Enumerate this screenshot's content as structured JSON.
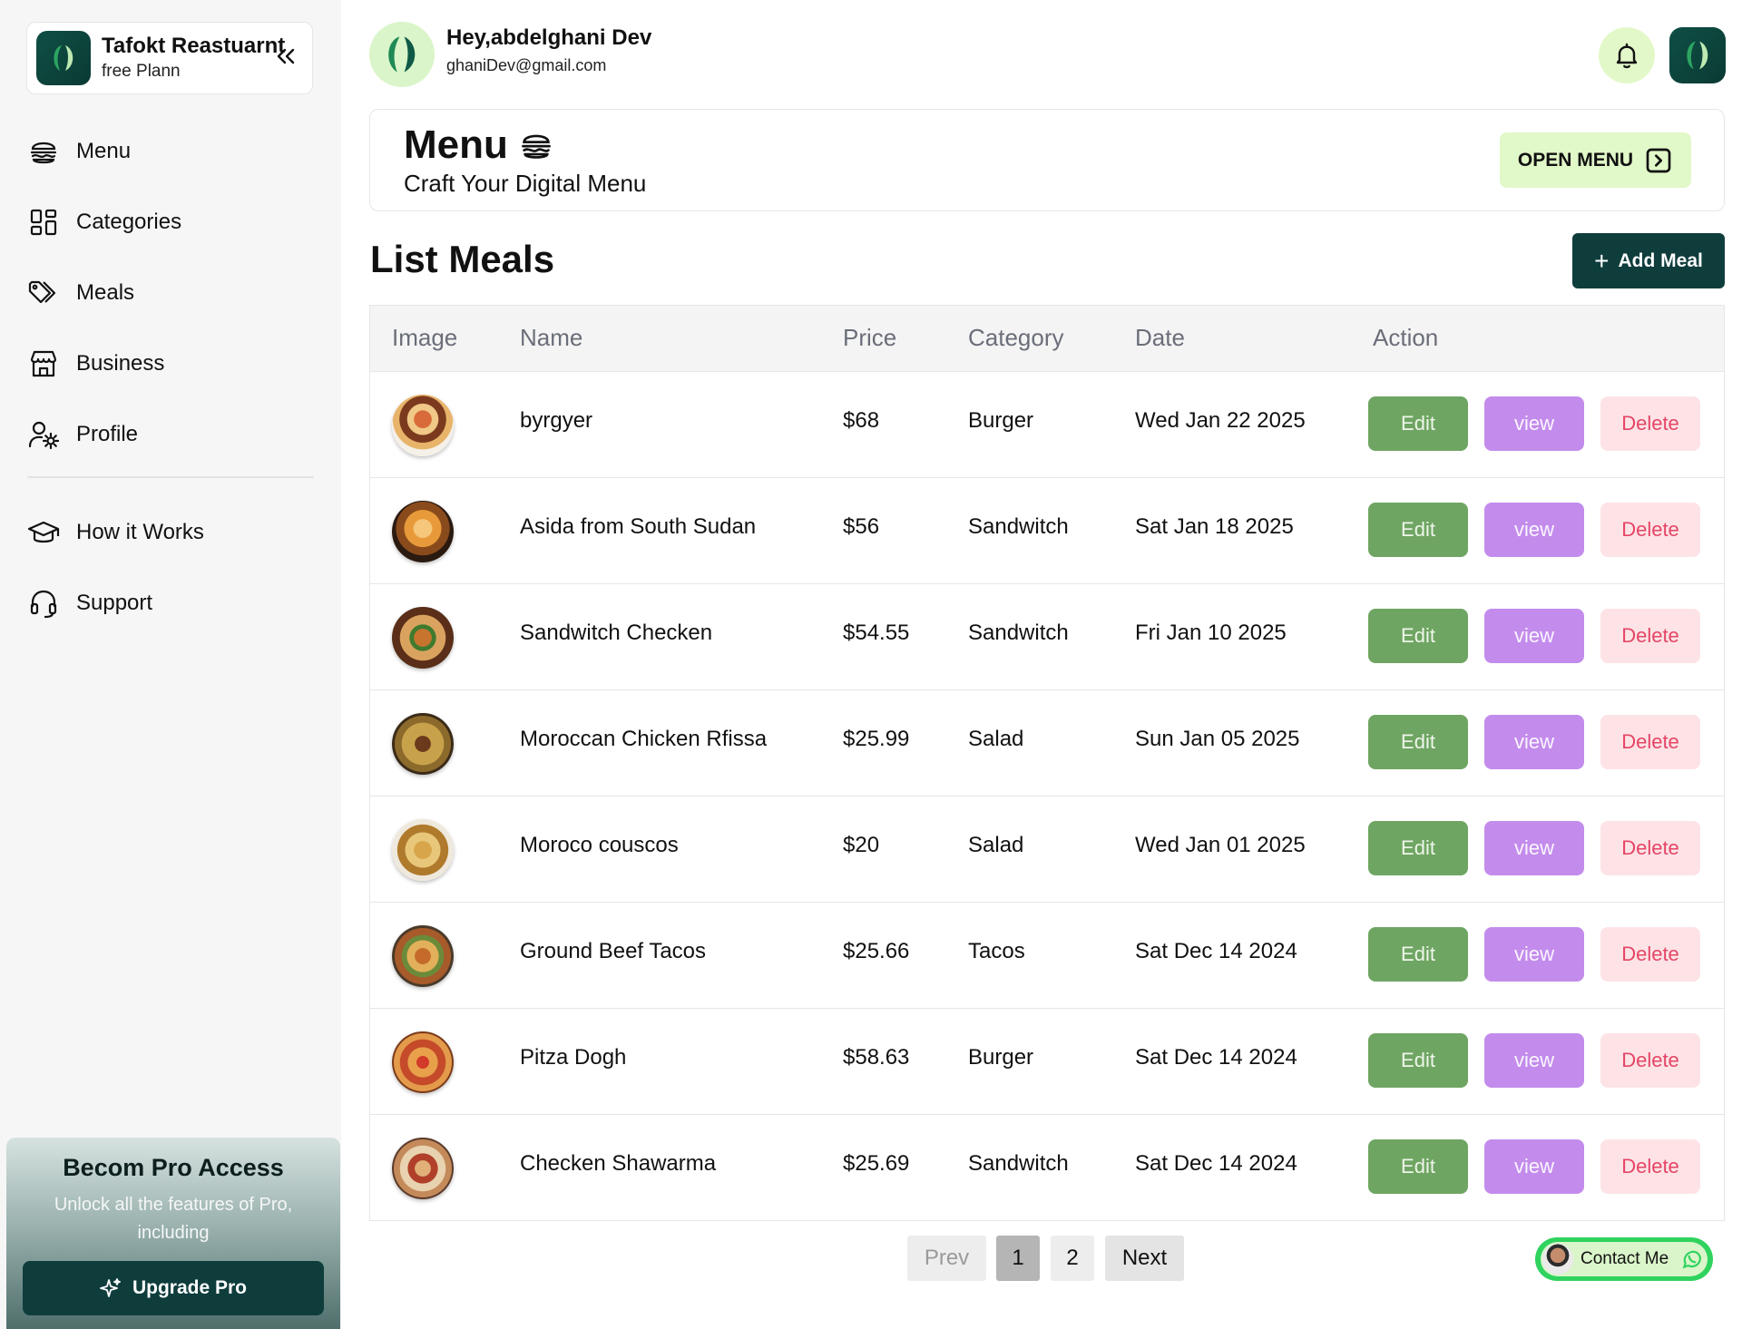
{
  "sidebar": {
    "brand_name": "Tafokt Reastuarnt",
    "brand_plan": "free Plann",
    "items": [
      {
        "label": "Menu",
        "icon": "burger-icon"
      },
      {
        "label": "Categories",
        "icon": "grid-icon"
      },
      {
        "label": "Meals",
        "icon": "tags-icon"
      },
      {
        "label": "Business",
        "icon": "store-icon"
      },
      {
        "label": "Profile",
        "icon": "user-gear-icon"
      }
    ],
    "secondary_items": [
      {
        "label": "How it Works",
        "icon": "graduation-cap-icon"
      },
      {
        "label": "Support",
        "icon": "headset-icon"
      }
    ],
    "pro": {
      "title": "Becom Pro Access",
      "description": "Unlock all the features of Pro, including",
      "button_label": "Upgrade Pro"
    }
  },
  "header": {
    "greeting": "Hey,abdelghani Dev",
    "email": "ghaniDev@gmail.com"
  },
  "hero": {
    "title": "Menu",
    "subtitle": "Craft Your Digital Menu",
    "open_menu_label": "OPEN MENU"
  },
  "main": {
    "list_title": "List Meals",
    "add_meal_label": "Add Meal",
    "columns": [
      "Image",
      "Name",
      "Price",
      "Category",
      "Date",
      "Action"
    ],
    "actions": {
      "edit": "Edit",
      "view": "view",
      "delete": "Delete"
    },
    "meals": [
      {
        "name": "byrgyer",
        "price": "$68",
        "category": "Burger",
        "date": "Wed Jan 22 2025"
      },
      {
        "name": "Asida from South Sudan",
        "price": "$56",
        "category": "Sandwitch",
        "date": "Sat Jan 18 2025"
      },
      {
        "name": "Sandwitch Checken",
        "price": "$54.55",
        "category": "Sandwitch",
        "date": "Fri Jan 10 2025"
      },
      {
        "name": "Moroccan Chicken Rfissa",
        "price": "$25.99",
        "category": "Salad",
        "date": "Sun Jan 05 2025"
      },
      {
        "name": "Moroco couscos",
        "price": "$20",
        "category": "Salad",
        "date": "Wed Jan 01 2025"
      },
      {
        "name": "Ground Beef Tacos",
        "price": "$25.66",
        "category": "Tacos",
        "date": "Sat Dec 14 2024"
      },
      {
        "name": "Pitza Dogh",
        "price": "$58.63",
        "category": "Burger",
        "date": "Sat Dec 14 2024"
      },
      {
        "name": "Checken Shawarma",
        "price": "$25.69",
        "category": "Sandwitch",
        "date": "Sat Dec 14 2024"
      }
    ]
  },
  "pagination": {
    "prev": "Prev",
    "pages": [
      "1",
      "2"
    ],
    "next": "Next",
    "current": "1"
  },
  "contact": {
    "label": "Contact Me"
  },
  "colors": {
    "brand_dark": "#0e3d3c",
    "accent_light_green": "#e1f8c8",
    "edit": "#6fa562",
    "view": "#c38cec",
    "delete_bg": "#fde3e6",
    "delete_text": "#e54566"
  }
}
